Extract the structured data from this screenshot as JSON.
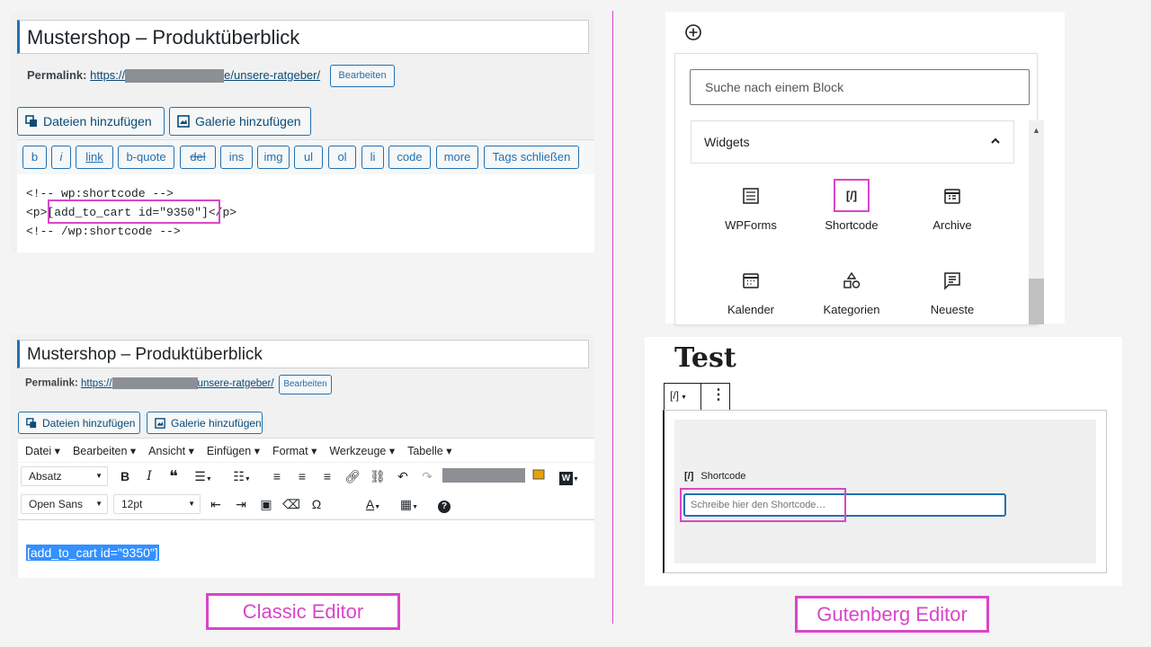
{
  "classic_top": {
    "title": "Mustershop – Produktüberblick",
    "permalink_label": "Permalink:",
    "permalink_prefix": "https://",
    "permalink_suffix": "e/unsere-ratgeber/",
    "edit_button": "Bearbeiten",
    "add_media": "Dateien hinzufügen",
    "add_gallery": "Galerie hinzufügen",
    "quicktags": [
      "b",
      "i",
      "link",
      "b-quote",
      "del",
      "ins",
      "img",
      "ul",
      "ol",
      "li",
      "code",
      "more",
      "Tags schließen"
    ],
    "code_lines": [
      "<!-- wp:shortcode -->",
      "<p>[add_to_cart id=\"9350\"]</p>",
      "<!-- /wp:shortcode -->"
    ],
    "code_line2_open": "<p>",
    "code_line2_shortcode": "[add_to_cart id=\"9350\"]",
    "code_line2_close": "</p>"
  },
  "classic_bottom": {
    "title": "Mustershop – Produktüberblick",
    "permalink_label": "Permalink:",
    "permalink_prefix": "https://",
    "permalink_suffix": "unsere-ratgeber/",
    "edit_button": "Bearbeiten",
    "add_media": "Dateien hinzufügen",
    "add_gallery": "Galerie hinzufügen",
    "menu": [
      "Datei ▾",
      "Bearbeiten ▾",
      "Ansicht ▾",
      "Einfügen ▾",
      "Format ▾",
      "Werkzeuge ▾",
      "Tabelle ▾"
    ],
    "format_select": "Absatz",
    "font_select": "Open Sans",
    "size_select": "12pt",
    "content": "[add_to_cart id=\"9350\"]"
  },
  "labels": {
    "classic": "Classic Editor",
    "gutenberg": "Gutenberg Editor"
  },
  "gutenberg_top": {
    "search_placeholder": "Suche nach einem Block",
    "category": "Widgets",
    "blocks": [
      "WPForms",
      "Shortcode",
      "Archive",
      "Kalender",
      "Kategorien",
      "Neueste"
    ]
  },
  "gutenberg_bottom": {
    "title": "Test",
    "toolbar_icon": "[/]",
    "block_label": "Shortcode",
    "input_placeholder": "Schreibe hier den Shortcode…"
  },
  "colors": {
    "highlight": "#d946c8",
    "wp_blue": "#2271b1",
    "selection": "#3390ff"
  }
}
